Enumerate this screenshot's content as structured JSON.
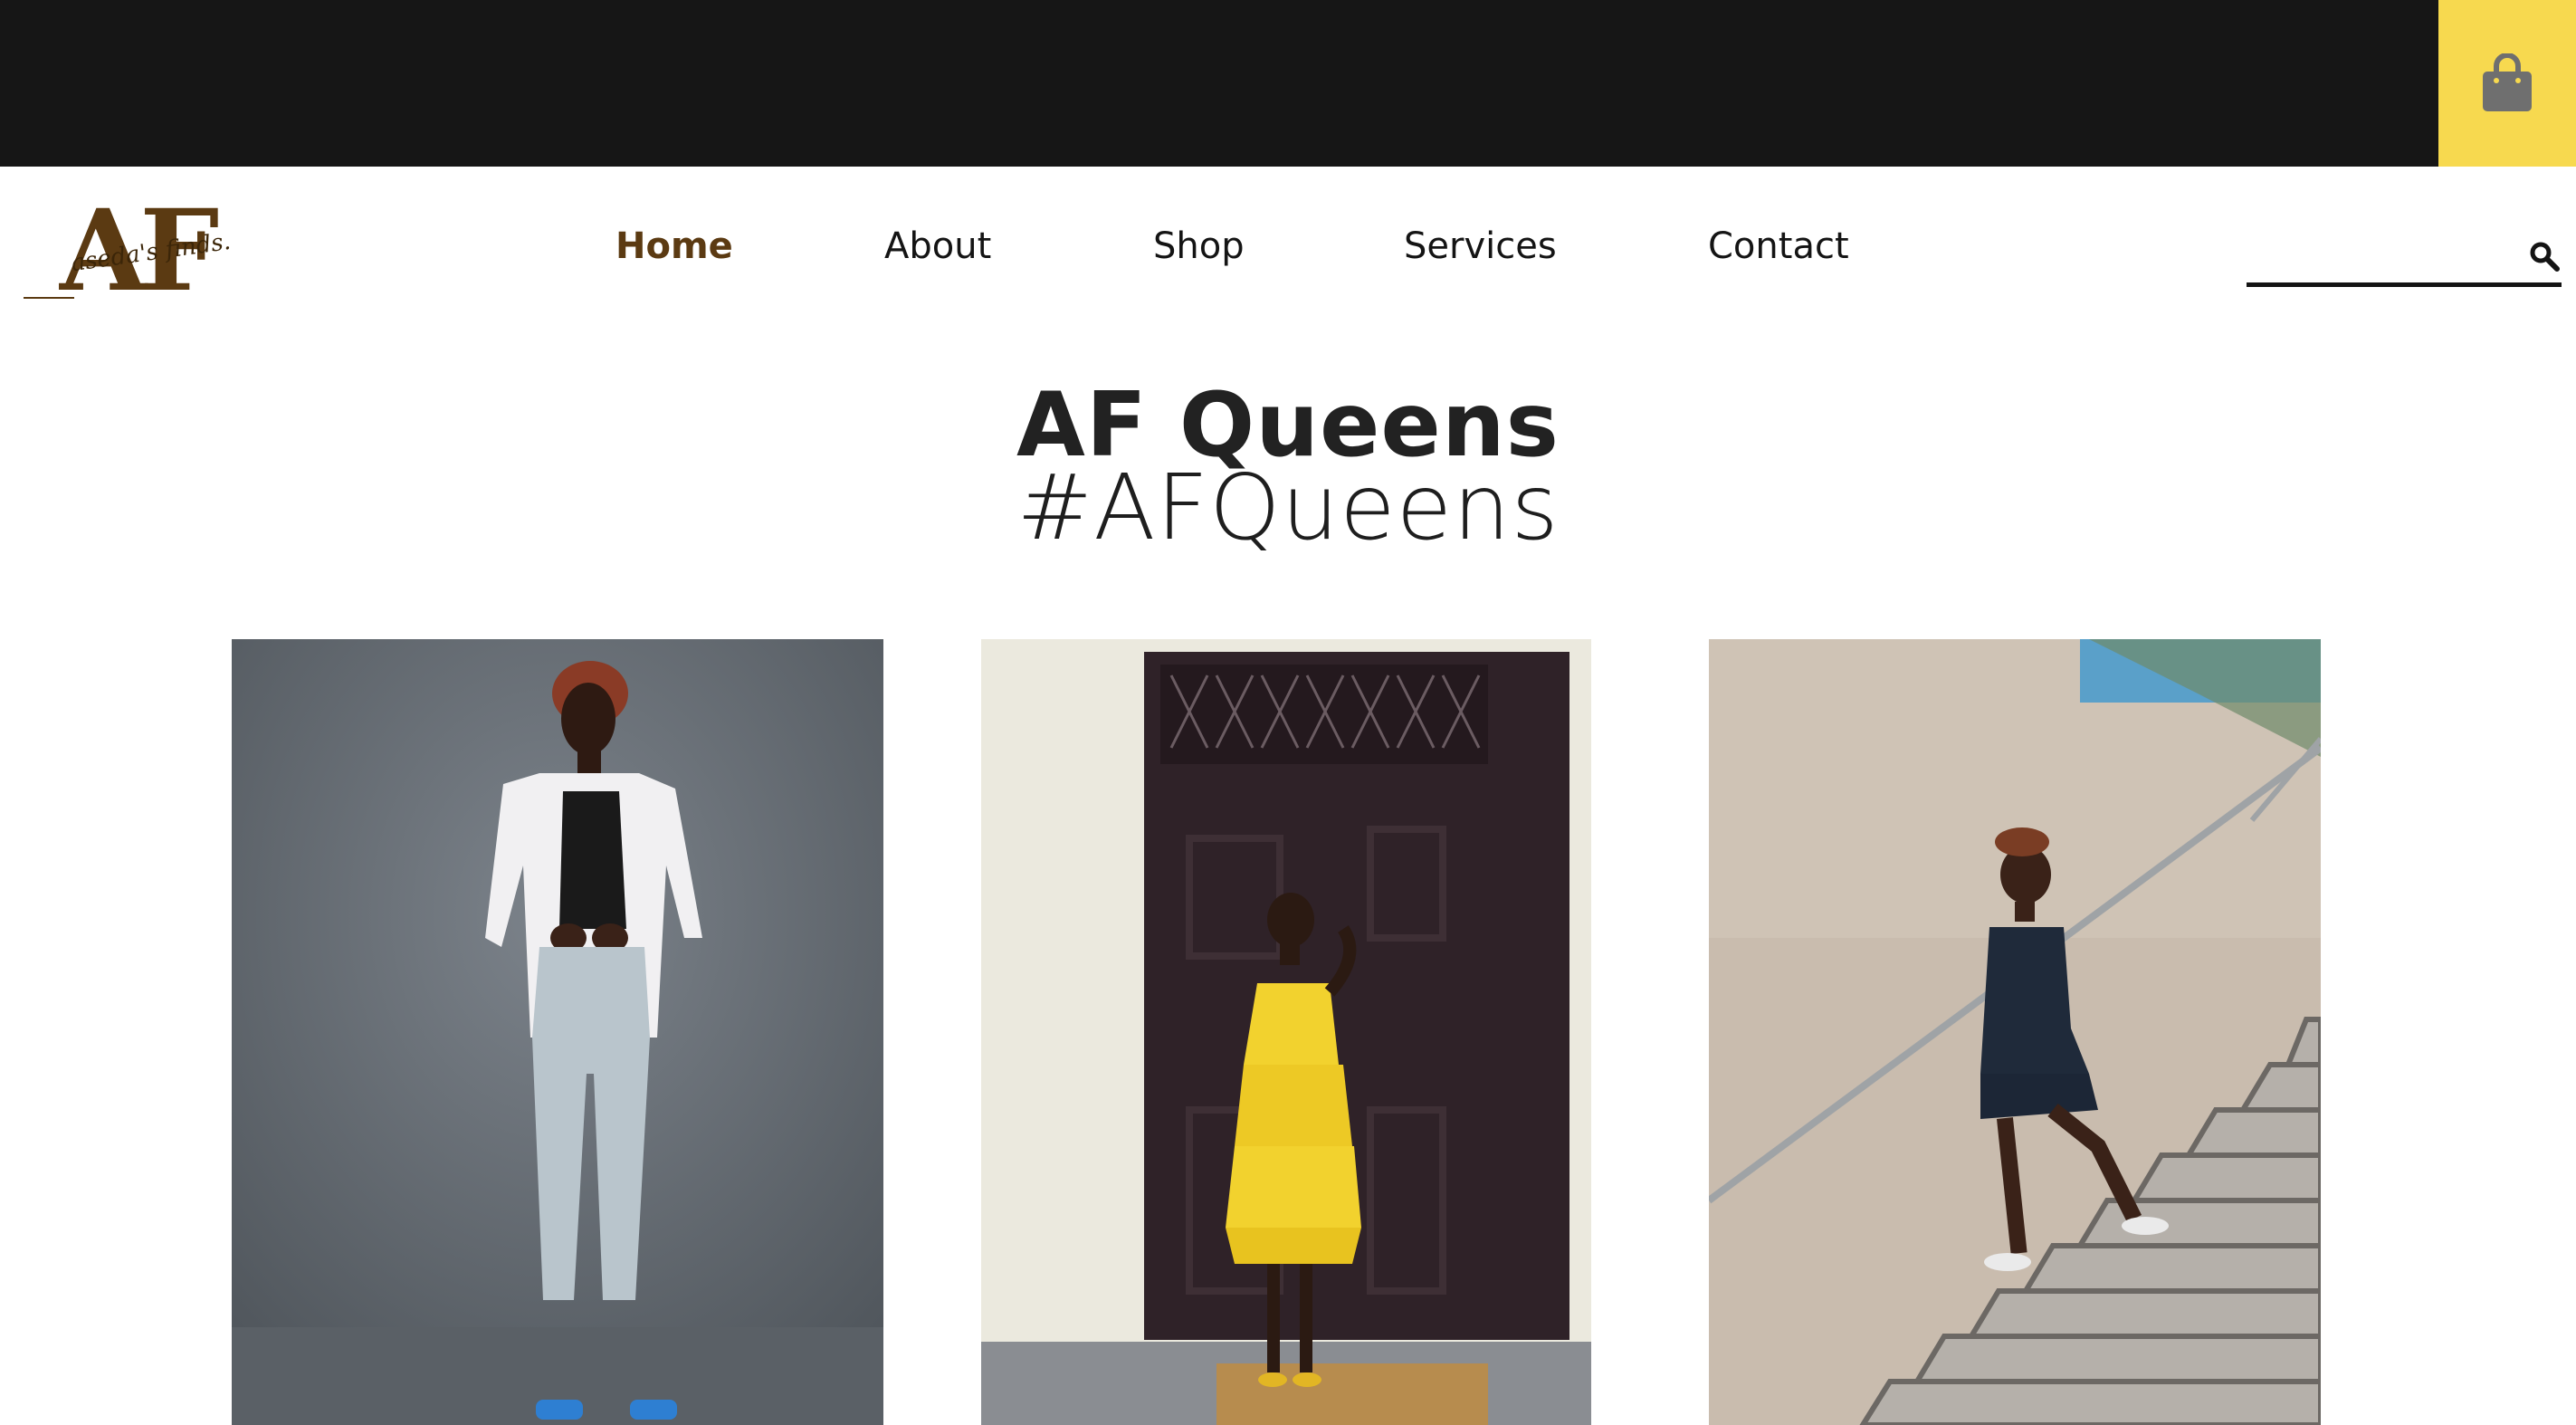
{
  "topbar": {
    "cart_icon": "shopping-bag-icon",
    "cart_color": "#f7d94f",
    "bar_color": "#161616"
  },
  "brand": {
    "logo_letters": "AF",
    "logo_script": "aseda's finds.",
    "brand_color": "#5b3a12"
  },
  "nav": {
    "items": [
      {
        "label": "Home",
        "active": true
      },
      {
        "label": "About",
        "active": false
      },
      {
        "label": "Shop",
        "active": false
      },
      {
        "label": "Services",
        "active": false
      },
      {
        "label": "Contact",
        "active": false
      }
    ],
    "active_color": "#5b3a12"
  },
  "search": {
    "value": "",
    "icon": "search-icon"
  },
  "hero": {
    "title": "AF Queens",
    "subtitle": "#AFQueens"
  },
  "gallery": {
    "photos": [
      {
        "description_icon": "model-white-shirt-jeans-photo"
      },
      {
        "description_icon": "model-yellow-dress-door-photo"
      },
      {
        "description_icon": "model-navy-romper-stairs-photo"
      }
    ]
  }
}
